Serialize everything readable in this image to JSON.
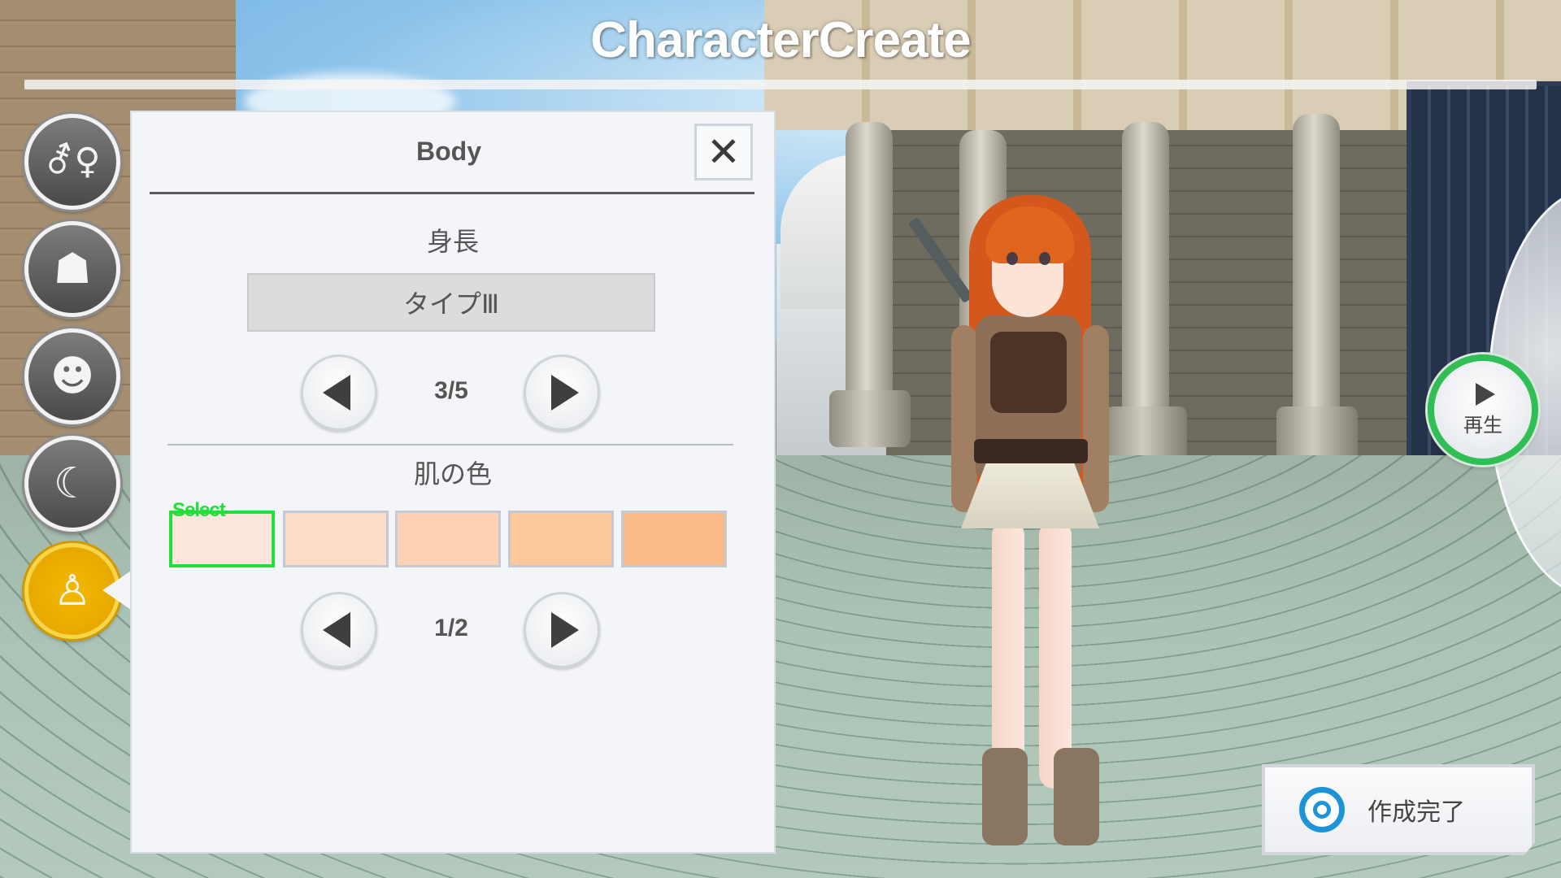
{
  "header": {
    "title": "CharacterCreate"
  },
  "sidebar": {
    "tabs": [
      {
        "icon": "gender-icon",
        "glyph": "⚦♀",
        "active": false
      },
      {
        "icon": "hair-icon",
        "glyph": "☗",
        "active": false
      },
      {
        "icon": "face-icon",
        "glyph": "☻",
        "active": false
      },
      {
        "icon": "makeup-brush-icon",
        "glyph": "☾",
        "active": false
      },
      {
        "icon": "body-icon",
        "glyph": "♙",
        "active": true
      }
    ]
  },
  "panel": {
    "title": "Body",
    "close_glyph": "✕",
    "height_section": {
      "label": "身長",
      "value": "タイプⅢ",
      "counter": "3/5"
    },
    "skin_section": {
      "label": "肌の色",
      "select_tag": "Select",
      "swatches": [
        "#fde6dc",
        "#fddcc7",
        "#fdd2b4",
        "#fdc89c",
        "#fcba86"
      ],
      "selected_index": 0,
      "counter": "1/2"
    }
  },
  "play_button": {
    "label": "再生"
  },
  "done_button": {
    "label": "作成完了"
  },
  "colors": {
    "accent_green": "#21e03a",
    "active_tab": "#f2b800",
    "done_icon": "#1e94d8"
  }
}
